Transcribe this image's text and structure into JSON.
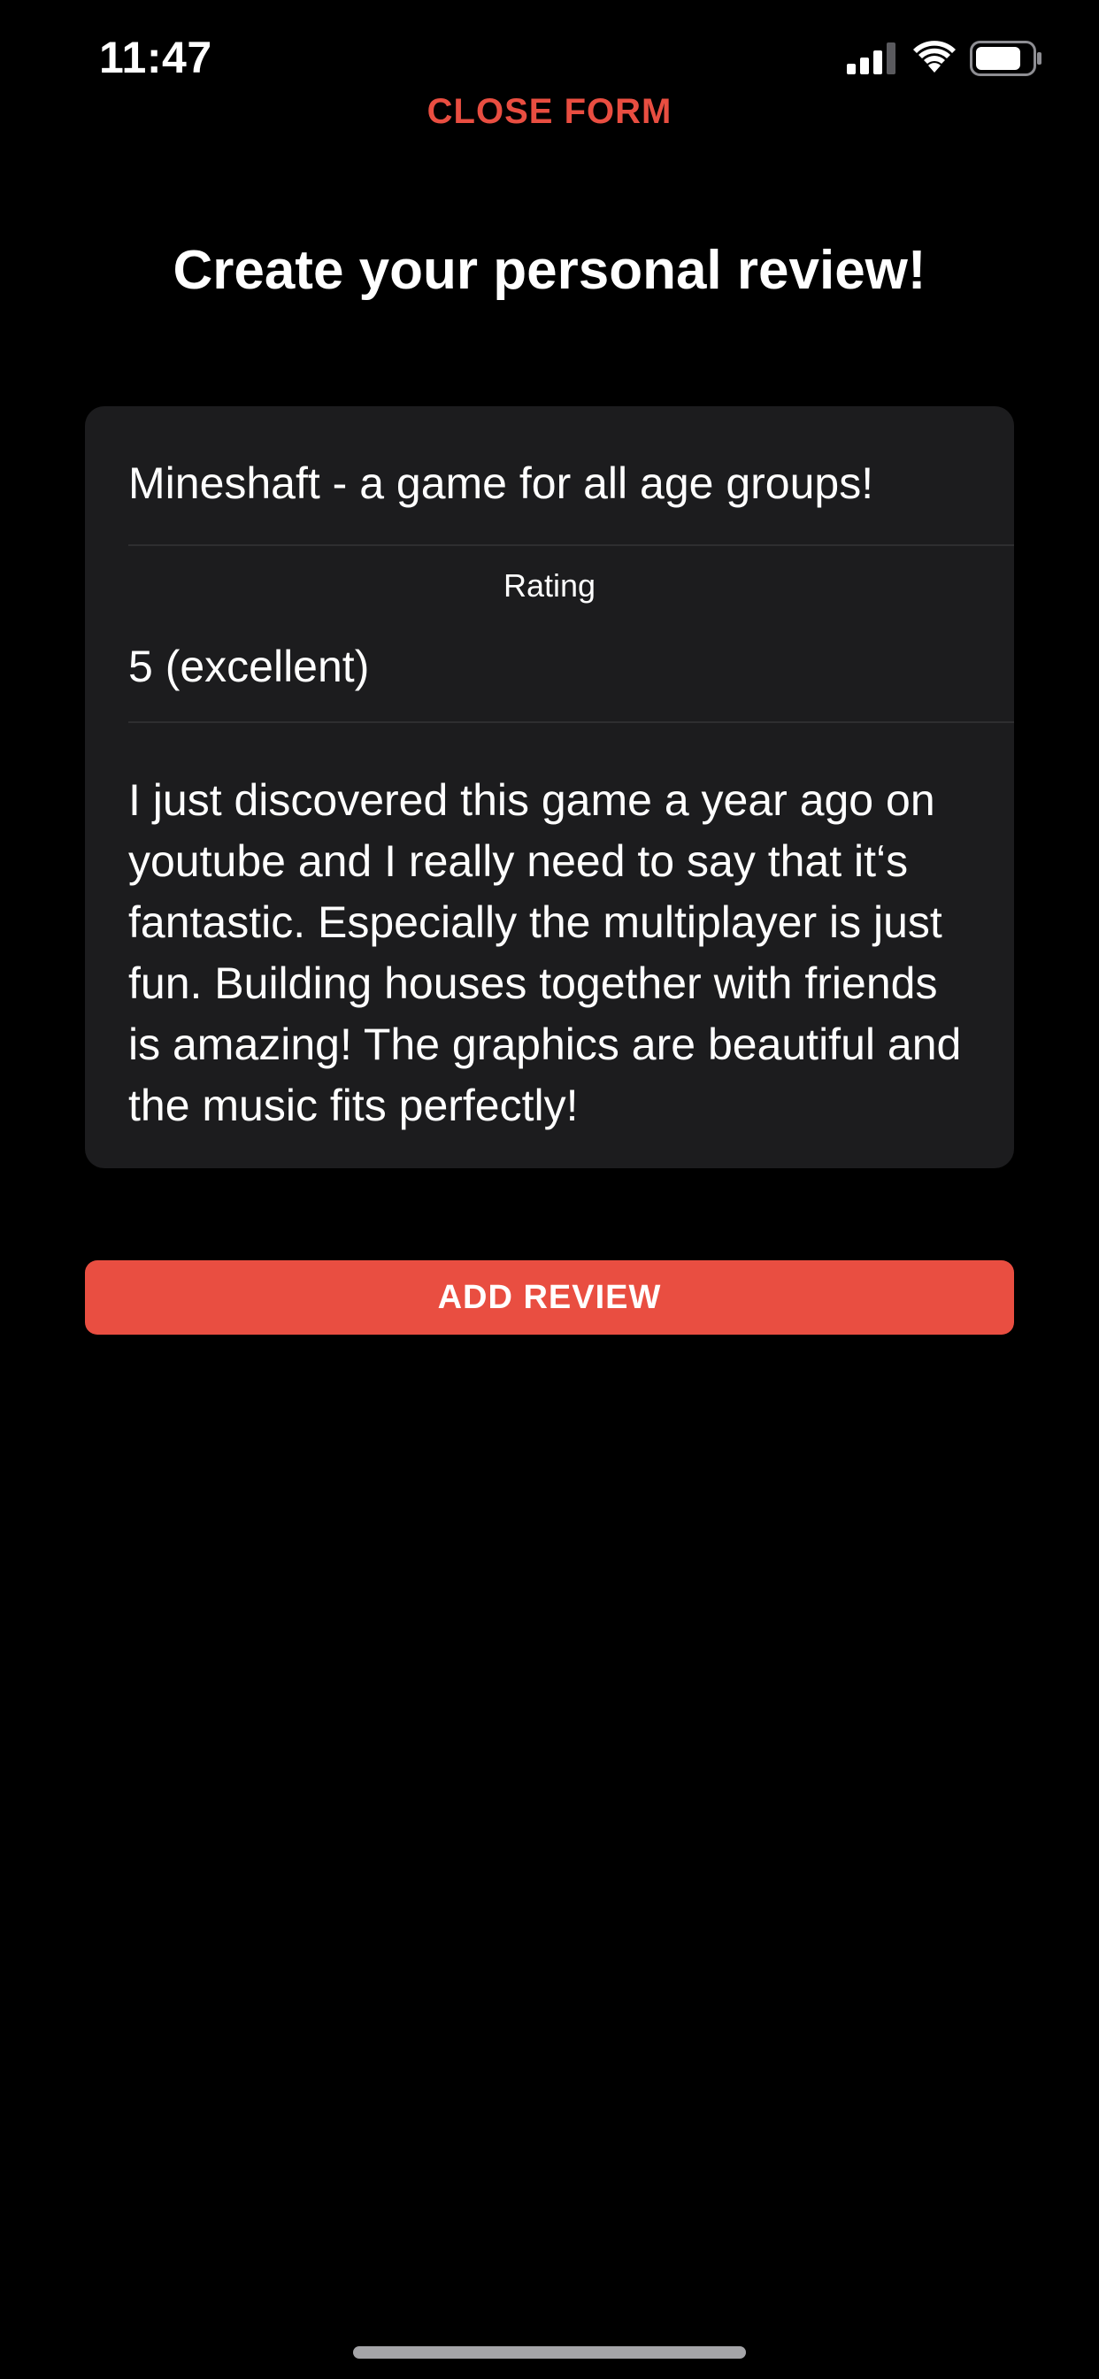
{
  "status_bar": {
    "time": "11:47",
    "signal_icon": "cellular-signal-icon",
    "wifi_icon": "wifi-icon",
    "battery_icon": "battery-icon",
    "battery_level": 0.8
  },
  "header": {
    "close_label": "CLOSE FORM",
    "title": "Create your personal review!"
  },
  "form": {
    "title_value": "Mineshaft - a game for all age groups!",
    "rating_label": "Rating",
    "rating_value": "5 (excellent)",
    "review_text": "I just discovered this game a year ago on youtube and I really need to say that it‘s fantastic. Especially the multiplayer is just fun. Building houses together with friends is amazing! The graphics are beautiful and the music fits perfectly!"
  },
  "actions": {
    "add_review_label": "ADD REVIEW"
  },
  "colors": {
    "accent": "#e94e41",
    "background": "#000000",
    "card": "#1c1c1e"
  }
}
